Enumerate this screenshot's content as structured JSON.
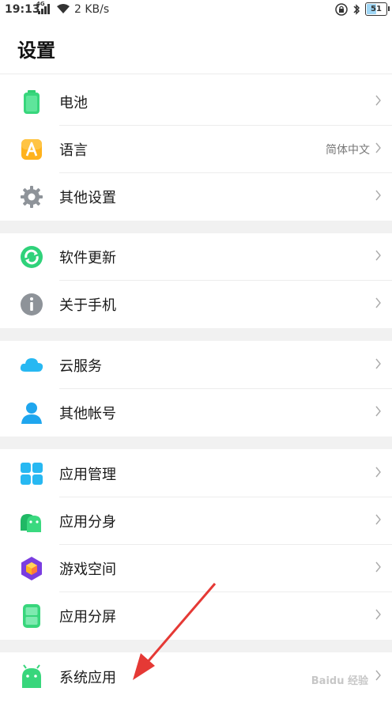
{
  "status_bar": {
    "time": "19:13",
    "network": "4G",
    "speed": "2 KB/s",
    "battery": "51",
    "icons": [
      "signal-icon",
      "wifi-icon",
      "lock-rotation-icon",
      "bluetooth-icon",
      "battery-icon"
    ]
  },
  "header": {
    "title": "设置"
  },
  "items": [
    {
      "label": "电池",
      "value": "",
      "icon": "battery-icon"
    },
    {
      "label": "语言",
      "value": "简体中文",
      "icon": "language-icon"
    },
    {
      "label": "其他设置",
      "value": "",
      "icon": "gear-icon"
    },
    {
      "label": "软件更新",
      "value": "",
      "icon": "update-icon"
    },
    {
      "label": "关于手机",
      "value": "",
      "icon": "info-icon"
    },
    {
      "label": "云服务",
      "value": "",
      "icon": "cloud-icon"
    },
    {
      "label": "其他帐号",
      "value": "",
      "icon": "person-icon"
    },
    {
      "label": "应用管理",
      "value": "",
      "icon": "app-grid-icon"
    },
    {
      "label": "应用分身",
      "value": "",
      "icon": "android-icon"
    },
    {
      "label": "游戏空间",
      "value": "",
      "icon": "cube-icon"
    },
    {
      "label": "应用分屏",
      "value": "",
      "icon": "split-screen-icon"
    },
    {
      "label": "系统应用",
      "value": "",
      "icon": "android-icon"
    }
  ],
  "watermark": "Baidu 经验",
  "colors": {
    "accent_green": "#34d17c",
    "gap": "#f1f1f1",
    "arrow": "#e53935"
  }
}
